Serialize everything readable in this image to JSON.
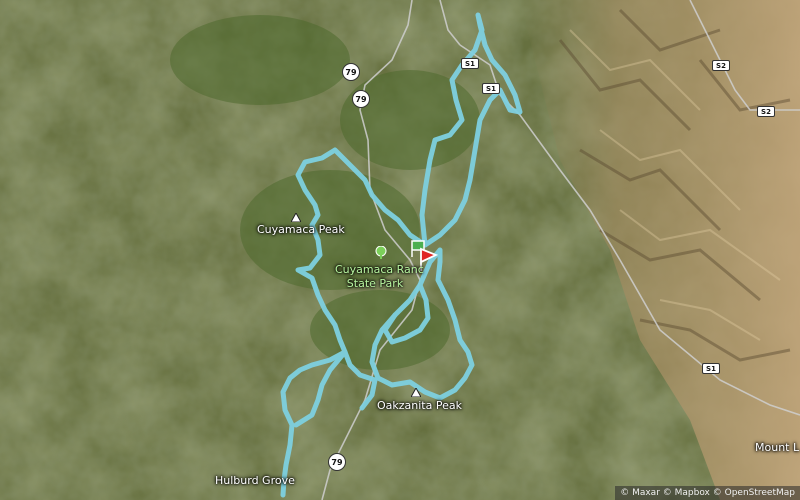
{
  "map": {
    "route_color": "#7ed0e0",
    "places": {
      "cuyamaca_peak": "Cuyamaca Peak",
      "park_line1": "Cuyamaca Ranc",
      "park_line2": "State Park",
      "oakzanita_peak": "Oakzanita Peak",
      "hulburd_grove": "Hulburd Grove",
      "mount": "Mount L"
    },
    "road_shields": {
      "r79_a": "79",
      "r79_b": "79",
      "r79_c": "79",
      "s1_a": "S1",
      "s1_b": "S1",
      "s1_c": "S1",
      "s2_a": "S2",
      "s2_b": "S2"
    },
    "attribution": "© Maxar © Mapbox © OpenStreetMap",
    "icons": [
      "peak-icon",
      "tree-icon",
      "start-flag-icon",
      "end-flag-icon"
    ]
  }
}
